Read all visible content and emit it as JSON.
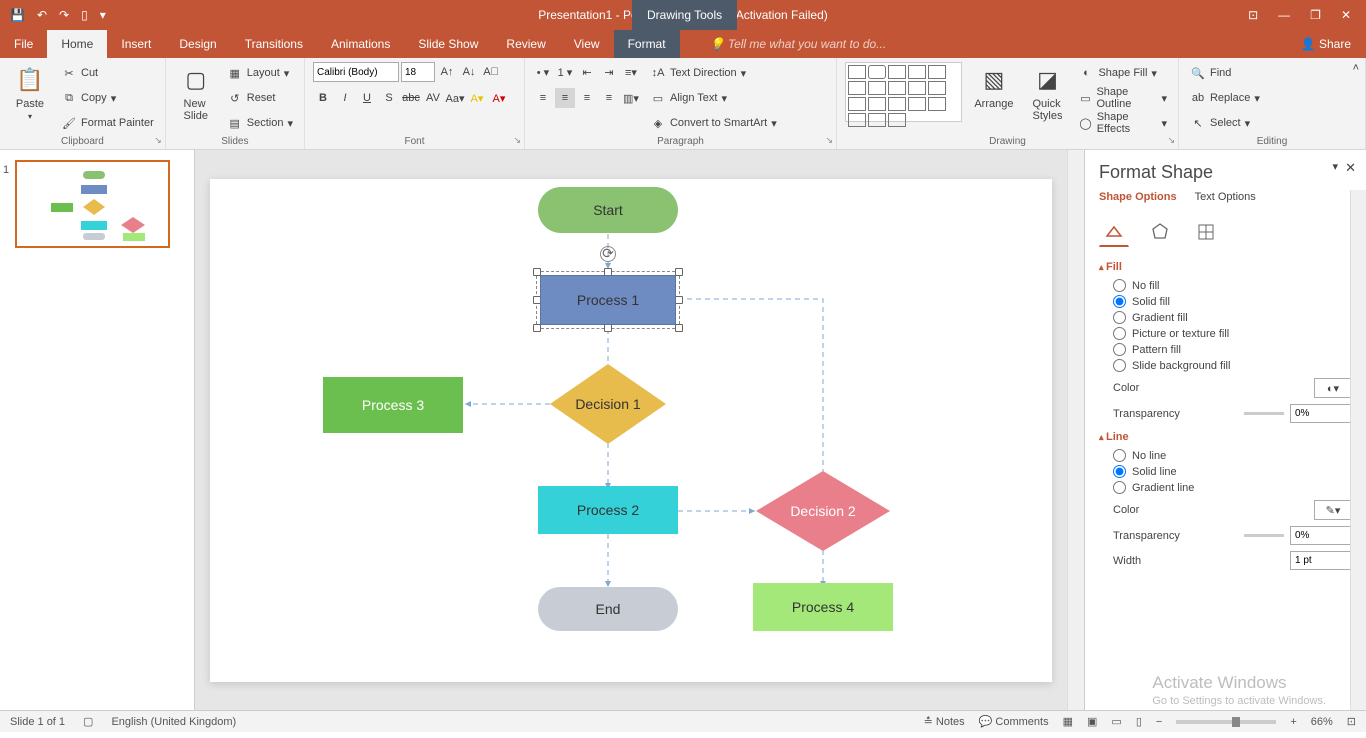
{
  "titlebar": {
    "title": "Presentation1 - PowerPoint (Product Activation Failed)",
    "drawing_tools": "Drawing Tools"
  },
  "tabs": {
    "file": "File",
    "home": "Home",
    "insert": "Insert",
    "design": "Design",
    "transitions": "Transitions",
    "animations": "Animations",
    "slideshow": "Slide Show",
    "review": "Review",
    "view": "View",
    "format": "Format",
    "tellme": "Tell me what you want to do...",
    "share": "Share"
  },
  "ribbon": {
    "clipboard": {
      "label": "Clipboard",
      "paste": "Paste",
      "cut": "Cut",
      "copy": "Copy",
      "format_painter": "Format Painter"
    },
    "slides": {
      "label": "Slides",
      "new_slide": "New\nSlide",
      "layout": "Layout",
      "reset": "Reset",
      "section": "Section"
    },
    "font": {
      "label": "Font",
      "font_name": "Calibri (Body)",
      "font_size": "18"
    },
    "paragraph": {
      "label": "Paragraph",
      "text_direction": "Text Direction",
      "align_text": "Align Text",
      "smartart": "Convert to SmartArt"
    },
    "drawing": {
      "label": "Drawing",
      "arrange": "Arrange",
      "quick_styles": "Quick\nStyles",
      "shape_fill": "Shape Fill",
      "shape_outline": "Shape Outline",
      "shape_effects": "Shape Effects"
    },
    "editing": {
      "label": "Editing",
      "find": "Find",
      "replace": "Replace",
      "select": "Select"
    }
  },
  "slides_panel": {
    "slide1_num": "1"
  },
  "flowchart": {
    "start": "Start",
    "process1": "Process 1",
    "decision1": "Decision 1",
    "process3": "Process 3",
    "process2": "Process 2",
    "decision2": "Decision 2",
    "process4": "Process 4",
    "end": "End"
  },
  "format_pane": {
    "title": "Format Shape",
    "shape_options": "Shape Options",
    "text_options": "Text Options",
    "fill_section": "Fill",
    "fill": {
      "no_fill": "No fill",
      "solid_fill": "Solid fill",
      "gradient_fill": "Gradient fill",
      "picture_fill": "Picture or texture fill",
      "pattern_fill": "Pattern fill",
      "slide_bg_fill": "Slide background fill",
      "color": "Color",
      "transparency": "Transparency",
      "transparency_val": "0%"
    },
    "line_section": "Line",
    "line": {
      "no_line": "No line",
      "solid_line": "Solid line",
      "gradient_line": "Gradient line",
      "color": "Color",
      "transparency": "Transparency",
      "transparency_val": "0%",
      "width": "Width",
      "width_val": "1 pt"
    }
  },
  "statusbar": {
    "slide": "Slide 1 of 1",
    "language": "English (United Kingdom)",
    "notes": "Notes",
    "comments": "Comments",
    "zoom": "66%"
  },
  "watermark": {
    "title": "Activate Windows",
    "sub": "Go to Settings to activate Windows."
  }
}
